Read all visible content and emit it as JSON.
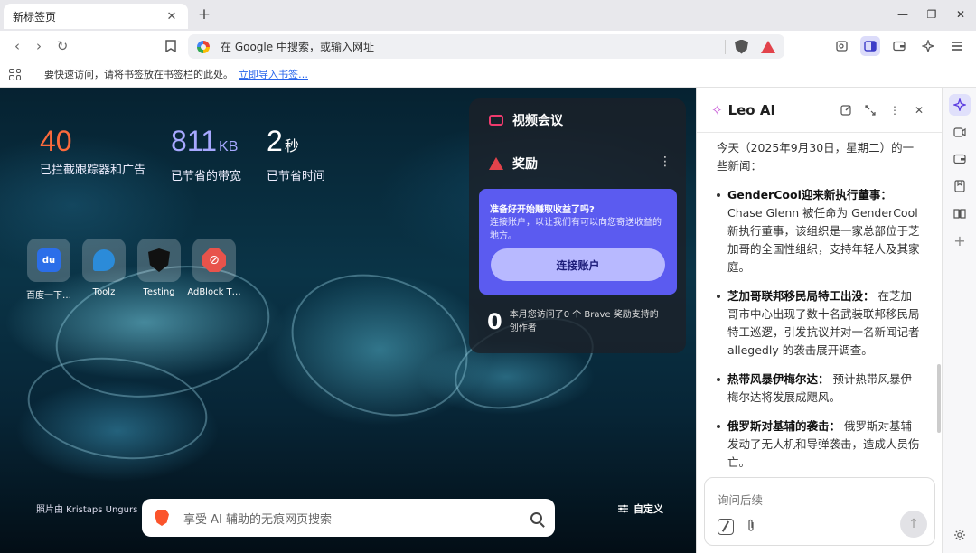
{
  "tab": {
    "title": "新标签页",
    "close": "✕",
    "new": "+"
  },
  "window": {
    "minimize": "—",
    "restore": "❐",
    "close": "✕"
  },
  "toolbar": {
    "back": "‹",
    "forward": "›",
    "reload": "↻",
    "bookmark": "🔖",
    "omnibox_placeholder": "在 Google 中搜索，或输入网址"
  },
  "bookmarks_bar": {
    "text": "要快速访问，请将书签放在书签栏的此处。",
    "link": "立即导入书签…"
  },
  "stats": [
    {
      "num": "40",
      "unit": "",
      "label": "已拦截跟踪器和广告"
    },
    {
      "num": "811",
      "unit": "KB",
      "label": "已节省的带宽"
    },
    {
      "num": "2",
      "unit": "秒",
      "label": "已节省时间"
    }
  ],
  "tiles": [
    {
      "name": "百度一下…",
      "icon_text": "du"
    },
    {
      "name": "Toolz"
    },
    {
      "name": "Testing"
    },
    {
      "name": "AdBlock T…",
      "icon_text": "⊘"
    }
  ],
  "widget": {
    "video": "视频会议",
    "rewards": "奖励",
    "menu": "⋮",
    "card_title": "准备好开始赚取收益了吗?",
    "card_desc": "连接账户，以让我们有可以向您寄送收益的地方。",
    "card_button": "连接账户",
    "count": "0",
    "count_text": "本月您访问了0 个 Brave 奖励支持的创作者"
  },
  "credit": "照片由 Kristaps Ungurs",
  "customize": "自定义",
  "ntp_search_placeholder": "享受 AI 辅助的无痕网页搜索",
  "leo": {
    "title": "Leo AI",
    "intro": "今天（2025年9月30日，星期二）的一些新闻：",
    "news": [
      {
        "head": "GenderCool迎来新执行董事：",
        "body": "Chase Glenn 被任命为 GenderCool 新执行董事，该组织是一家总部位于芝加哥的全国性组织，支持年轻人及其家庭。"
      },
      {
        "head": "芝加哥联邦移民局特工出没：",
        "body": "在芝加哥市中心出现了数十名武装联邦移民局特工巡逻，引发抗议并对一名新闻记者 allegedly 的袭击展开调查。"
      },
      {
        "head": "热带风暴伊梅尔达：",
        "body": "预计热带风暴伊梅尔达将发展成飓风。"
      },
      {
        "head": "俄罗斯对基辅的袭击：",
        "body": "俄罗斯对基辅发动了无人机和导弹袭击，造成人员伤亡。"
      }
    ],
    "input_placeholder": "询问后续"
  }
}
